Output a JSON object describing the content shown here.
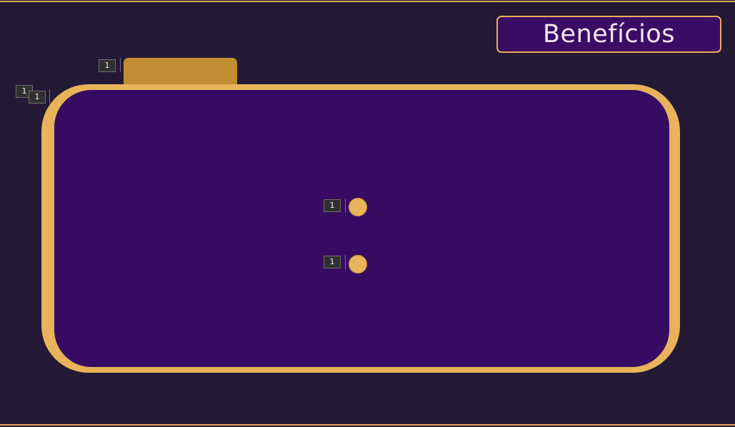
{
  "header": {
    "title": "Benefícios"
  },
  "badges": {
    "tab": "1",
    "corner_back": "1",
    "corner_front": "1",
    "dot_upper": "1",
    "dot_lower": "1"
  },
  "colors": {
    "background": "#241a36",
    "accent_gold": "#e8b35a",
    "tab_gold": "#c38e33",
    "panel_purple": "#360b61",
    "title_text": "#f1e6f6"
  }
}
